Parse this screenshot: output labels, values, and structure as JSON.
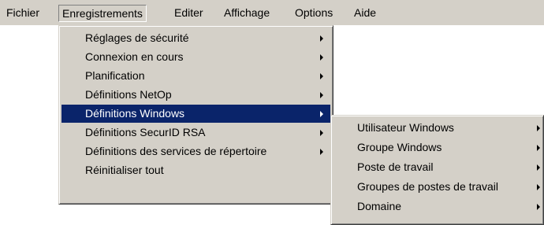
{
  "menubar": {
    "items": [
      {
        "label": "Fichier"
      },
      {
        "label": "Enregistrements"
      },
      {
        "label": "Editer"
      },
      {
        "label": "Affichage"
      },
      {
        "label": "Options"
      },
      {
        "label": "Aide"
      }
    ]
  },
  "enregistrements_menu": {
    "items": [
      {
        "label": "Réglages de sécurité"
      },
      {
        "label": "Connexion en cours"
      },
      {
        "label": "Planification"
      },
      {
        "label": "Définitions NetOp"
      },
      {
        "label": "Définitions Windows"
      },
      {
        "label": "Définitions SecurID RSA"
      },
      {
        "label": "Définitions des services de répertoire"
      },
      {
        "label": "Réinitialiser tout"
      }
    ]
  },
  "windows_submenu": {
    "items": [
      {
        "label": "Utilisateur Windows"
      },
      {
        "label": "Groupe Windows"
      },
      {
        "label": "Poste de travail"
      },
      {
        "label": "Groupes de postes de travail"
      },
      {
        "label": "Domaine"
      }
    ]
  },
  "colors": {
    "menu_background": "#d4d0c8",
    "highlight": "#0a246a",
    "highlight_text": "#ffffff"
  },
  "icons": {
    "submenu_arrow": "arrow-right-icon"
  }
}
